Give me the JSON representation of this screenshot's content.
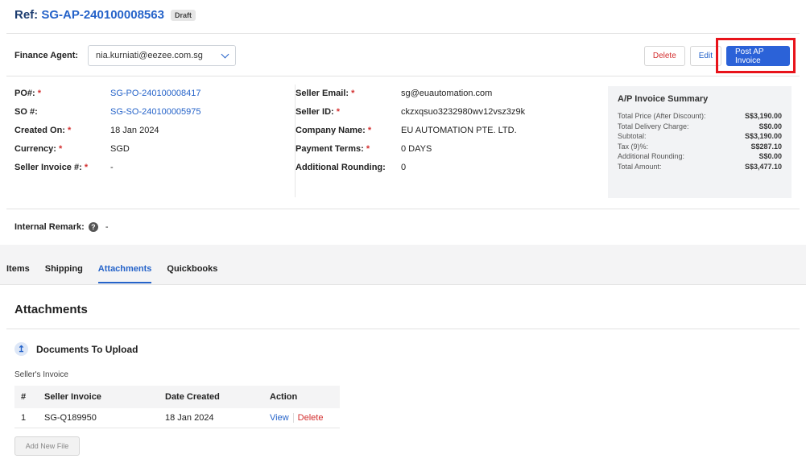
{
  "header": {
    "ref_prefix": "Ref:",
    "ref_number": "SG-AP-240100008563",
    "status": "Draft"
  },
  "agent": {
    "label": "Finance Agent:",
    "value": "nia.kurniati@eezee.com.sg"
  },
  "actions": {
    "delete": "Delete",
    "edit": "Edit",
    "post": "Post AP Invoice"
  },
  "details_left": [
    {
      "label": "PO#:",
      "required": "*",
      "value": "SG-PO-240100008417"
    },
    {
      "label": "SO #:",
      "required": "",
      "value": "SG-SO-240100005975"
    },
    {
      "label": "Created On:",
      "required": "*",
      "value": "18 Jan 2024"
    },
    {
      "label": "Currency:",
      "required": "*",
      "value": "SGD"
    },
    {
      "label": "Seller Invoice #:",
      "required": "*",
      "value": "-"
    }
  ],
  "details_mid": [
    {
      "label": "Seller Email:",
      "required": "*",
      "value": "sg@euautomation.com"
    },
    {
      "label": "Seller ID:",
      "required": "*",
      "value": "ckzxqsuo3232980wv12vsz3z9k"
    },
    {
      "label": "Company Name:",
      "required": "*",
      "value": "EU AUTOMATION PTE. LTD."
    },
    {
      "label": "Payment Terms:",
      "required": "*",
      "value": "0 DAYS"
    },
    {
      "label": "Additional Rounding:",
      "required": "",
      "value": "0"
    }
  ],
  "summary": {
    "title": "A/P Invoice Summary",
    "rows": [
      {
        "label": "Total Price (After Discount):",
        "value": "S$3,190.00"
      },
      {
        "label": "Total Delivery Charge:",
        "value": "S$0.00"
      },
      {
        "label": "Subtotal:",
        "value": "S$3,190.00"
      },
      {
        "label": "Tax (9)%:",
        "value": "S$287.10"
      },
      {
        "label": "Additional Rounding:",
        "value": "S$0.00"
      },
      {
        "label": "Total Amount:",
        "value": "S$3,477.10"
      }
    ]
  },
  "remark": {
    "label": "Internal Remark:",
    "value": "-"
  },
  "tabs": [
    {
      "label": "Items"
    },
    {
      "label": "Shipping"
    },
    {
      "label": "Attachments"
    },
    {
      "label": "Quickbooks"
    }
  ],
  "attachments": {
    "title": "Attachments",
    "docs_title": "Documents To Upload",
    "section_label": "Seller's Invoice",
    "columns": [
      "#",
      "Seller Invoice",
      "Date Created",
      "Action"
    ],
    "rows": [
      {
        "num": "1",
        "invoice": "SG-Q189950",
        "date": "18 Jan 2024",
        "view": "View",
        "delete": "Delete"
      }
    ],
    "add_button": "Add New File"
  }
}
